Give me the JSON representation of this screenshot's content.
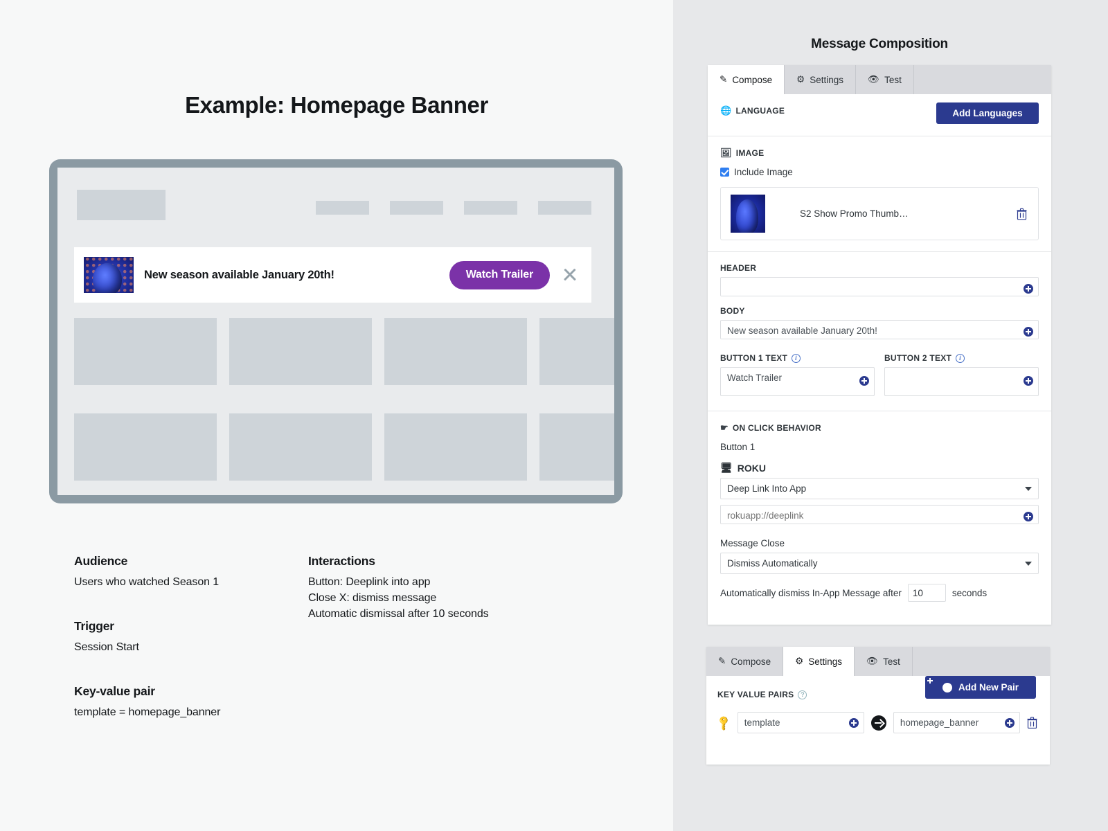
{
  "slide": {
    "title": "Example: Homepage Banner",
    "banner": {
      "message": "New season available January 20th!",
      "cta_label": "Watch Trailer",
      "close_icon": "close-x-icon"
    },
    "info": {
      "audience_heading": "Audience",
      "audience_value": "Users who watched Season 1",
      "trigger_heading": "Trigger",
      "trigger_value": "Session Start",
      "kvp_heading": "Key-value pair",
      "kvp_value": "template = homepage_banner",
      "interactions_heading": "Interactions",
      "interaction_1": "Button: Deeplink into app",
      "interaction_2": "Close X: dismiss message",
      "interaction_3": "Automatic dismissal after 10 seconds"
    }
  },
  "panel": {
    "title": "Message Composition",
    "compose": {
      "tabs": [
        {
          "label": "Compose",
          "icon": "pencil-icon",
          "active": true
        },
        {
          "label": "Settings",
          "icon": "gear-icon",
          "active": false
        },
        {
          "label": "Test",
          "icon": "eye-icon",
          "active": false
        }
      ],
      "language_label": "LANGUAGE",
      "add_languages_label": "Add Languages",
      "image_label": "IMAGE",
      "include_image_label": "Include Image",
      "image_name": "S2 Show Promo Thumb…",
      "header_label": "HEADER",
      "header_value": "",
      "body_label": "BODY",
      "body_value": "New season available January 20th!",
      "button1_label": "BUTTON 1 TEXT",
      "button1_value": "Watch Trailer",
      "button2_label": "BUTTON 2 TEXT",
      "button2_value": "",
      "on_click_label": "ON CLICK BEHAVIOR",
      "button_scope": "Button 1",
      "platform_label": "ROKU",
      "action_value": "Deep Link Into App",
      "deeplink_value": "rokuapp://deeplink",
      "message_close_label": "Message Close",
      "message_close_value": "Dismiss Automatically",
      "dismiss_prefix": "Automatically dismiss In-App Message after",
      "dismiss_seconds": "10",
      "dismiss_suffix": "seconds"
    },
    "settings": {
      "tabs": [
        {
          "label": "Compose",
          "icon": "pencil-icon",
          "active": false
        },
        {
          "label": "Settings",
          "icon": "gear-icon",
          "active": true
        },
        {
          "label": "Test",
          "icon": "eye-icon",
          "active": false
        }
      ],
      "kvp_label": "KEY VALUE PAIRS",
      "add_pair_label": "Add New Pair",
      "key_value": "template",
      "value_value": "homepage_banner"
    }
  },
  "colors": {
    "brand_navy": "#2b3a8f",
    "cta_purple": "#7b32a8",
    "device_frame": "#8b9aa3",
    "checkbox_blue": "#2f7ef0"
  }
}
